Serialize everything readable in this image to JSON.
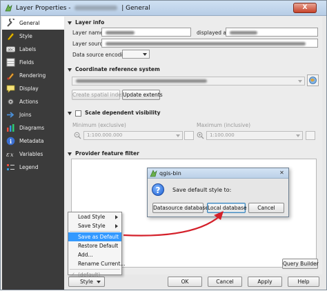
{
  "window": {
    "title_prefix": "Layer Properties - ",
    "title_suffix": " | General",
    "close_label": "X"
  },
  "sidebar": {
    "items": [
      {
        "label": "General",
        "icon": "wrench-icon"
      },
      {
        "label": "Style",
        "icon": "style-icon"
      },
      {
        "label": "Labels",
        "icon": "labels-icon"
      },
      {
        "label": "Fields",
        "icon": "fields-icon"
      },
      {
        "label": "Rendering",
        "icon": "paintbrush-icon"
      },
      {
        "label": "Display",
        "icon": "display-icon"
      },
      {
        "label": "Actions",
        "icon": "gear-icon"
      },
      {
        "label": "Joins",
        "icon": "joins-icon"
      },
      {
        "label": "Diagrams",
        "icon": "diagrams-icon"
      },
      {
        "label": "Metadata",
        "icon": "info-icon"
      },
      {
        "label": "Variables",
        "icon": "variables-icon"
      },
      {
        "label": "Legend",
        "icon": "legend-icon"
      }
    ]
  },
  "layer_info": {
    "heading": "Layer info",
    "layer_name_label": "Layer name",
    "displayed_as_label": "displayed as",
    "layer_source_label": "Layer source",
    "encoding_label": "Data source encoding"
  },
  "crs": {
    "heading": "Coordinate reference system",
    "create_index_label": "Create spatial index",
    "update_extents_label": "Update extents"
  },
  "scale": {
    "heading": "Scale dependent visibility",
    "min_label": "Minimum (exclusive)",
    "max_label": "Maximum (inclusive)",
    "min_value": "1:100.000.000",
    "max_value": "1:100.000"
  },
  "provider": {
    "heading": "Provider feature filter",
    "query_builder_label": "Query Builder"
  },
  "bottom": {
    "style_label": "Style",
    "ok_label": "OK",
    "cancel_label": "Cancel",
    "apply_label": "Apply",
    "help_label": "Help"
  },
  "style_menu": {
    "items": [
      {
        "label": "Load Style",
        "submenu": true
      },
      {
        "label": "Save Style",
        "submenu": true
      },
      {
        "label": "Save as Default",
        "highlighted": true
      },
      {
        "label": "Restore Default"
      },
      {
        "label": "Add..."
      },
      {
        "label": "Rename Current..."
      },
      {
        "label": "(default)"
      }
    ]
  },
  "dialog": {
    "title": "qgis-bin",
    "message": "Save default style to:",
    "datasource_label": "Datasource database",
    "local_label": "Local database",
    "cancel_label": "Cancel"
  },
  "colors": {
    "annotation_arrow": "#d4202a",
    "menu_highlight": "#3399ff",
    "sidebar_bg": "#3b3b3b"
  }
}
